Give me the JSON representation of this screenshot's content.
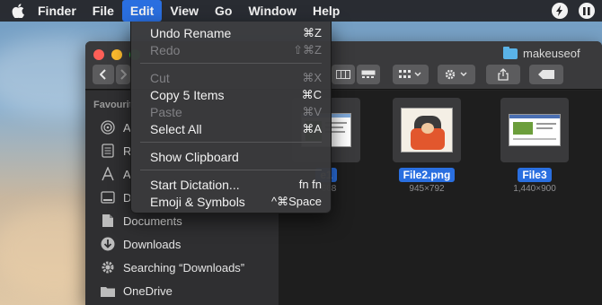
{
  "menubar": {
    "app": "Finder",
    "menus": [
      "File",
      "Edit",
      "View",
      "Go",
      "Window",
      "Help"
    ],
    "active_menu": "Edit"
  },
  "edit_menu": {
    "items": [
      {
        "label": "Undo Rename",
        "shortcut": "⌘Z",
        "enabled": true
      },
      {
        "label": "Redo",
        "shortcut": "⇧⌘Z",
        "enabled": false
      },
      {
        "label": "Cut",
        "shortcut": "⌘X",
        "enabled": false
      },
      {
        "label": "Copy 5 Items",
        "shortcut": "⌘C",
        "enabled": true
      },
      {
        "label": "Paste",
        "shortcut": "⌘V",
        "enabled": false
      },
      {
        "label": "Select All",
        "shortcut": "⌘A",
        "enabled": true
      },
      {
        "label": "Show Clipboard",
        "shortcut": "",
        "enabled": true
      },
      {
        "label": "Start Dictation...",
        "shortcut": "fn fn",
        "enabled": true
      },
      {
        "label": "Emoji & Symbols",
        "shortcut": "^⌘Space",
        "enabled": true
      }
    ]
  },
  "window": {
    "title": "makeuseof"
  },
  "sidebar": {
    "header": "Favourit",
    "partial_items": [
      "A",
      "R",
      "A",
      "D"
    ],
    "items": [
      "Documents",
      "Downloads",
      "Searching “Downloads”",
      "OneDrive"
    ]
  },
  "files": [
    {
      "name": "e1",
      "dims": "×668"
    },
    {
      "name": "File2.png",
      "dims": "945×792"
    },
    {
      "name": "File3",
      "dims": "1,440×900"
    }
  ],
  "colors": {
    "selection": "#2a6fe0",
    "menubar": "#232326",
    "menu_bg": "#3a3a3c",
    "window_bg": "#1e1e1e",
    "folder": "#5ab3e8"
  },
  "icons": {
    "menubar": [
      "apple-icon",
      "bolt-icon",
      "pause-icon"
    ],
    "toolbar": [
      "back-icon",
      "forward-icon",
      "column-view-icon",
      "gallery-view-icon",
      "group-icon",
      "action-gear-icon",
      "share-icon",
      "tag-icon"
    ],
    "sidebar": [
      "airdrop-icon",
      "recents-icon",
      "applications-icon",
      "desktop-icon",
      "documents-icon",
      "downloads-icon",
      "gear-icon",
      "folder-icon"
    ]
  }
}
